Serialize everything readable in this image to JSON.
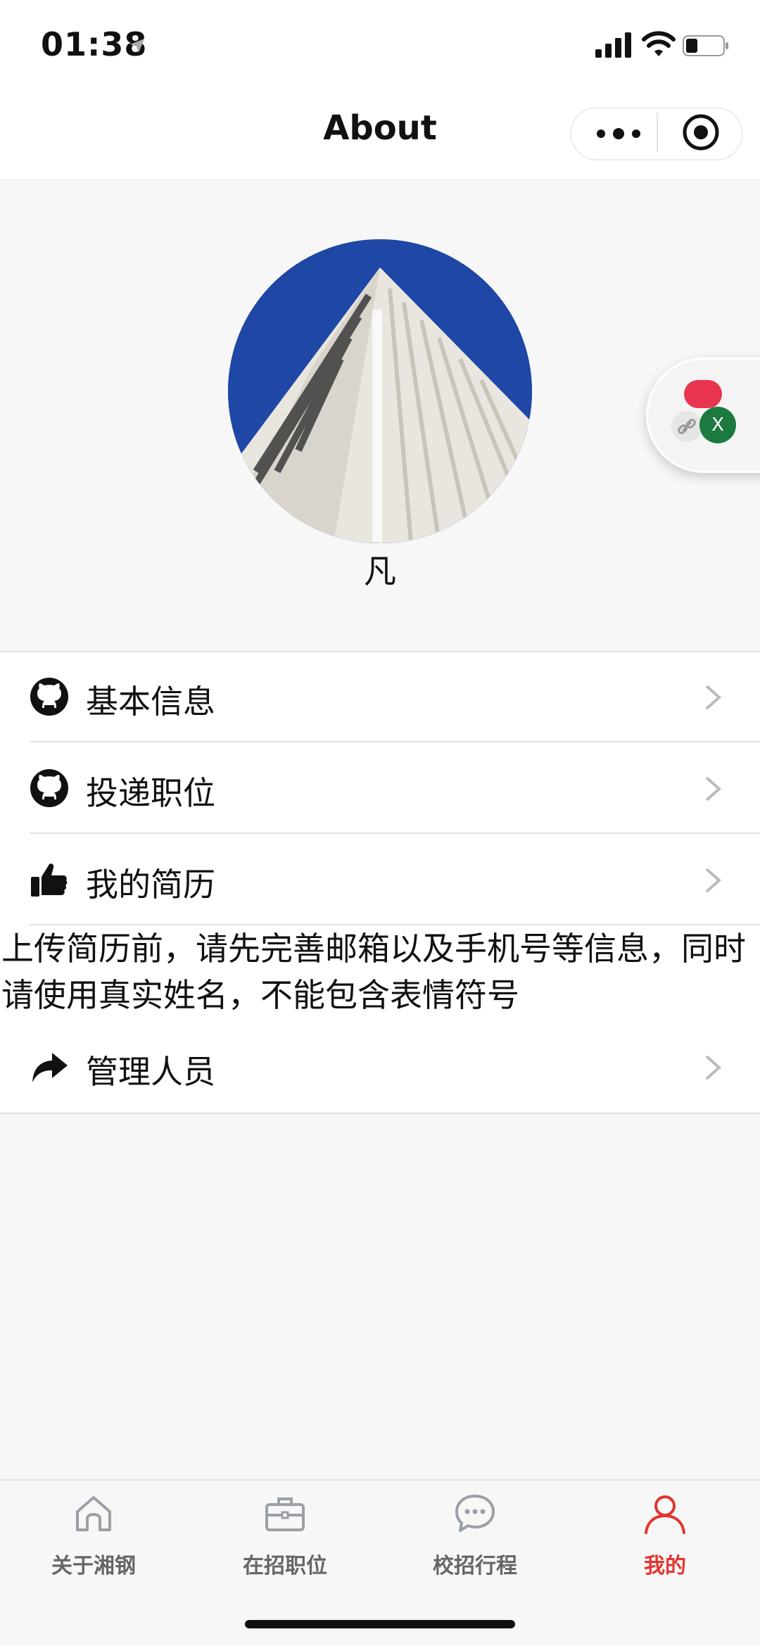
{
  "status_bar": {
    "time": "01:38"
  },
  "nav": {
    "title": "About"
  },
  "profile": {
    "username": "凡"
  },
  "menu": [
    {
      "label": "基本信息",
      "icon": "github-icon"
    },
    {
      "label": "投递职位",
      "icon": "github-icon"
    },
    {
      "label": "我的简历",
      "icon": "thumbs-up-icon"
    }
  ],
  "notice": {
    "line1": "上传简历前，请先完善邮箱以及手机号等信息，同时",
    "line2": "请使用真实姓名，不能包含表情符号"
  },
  "menu_extra": {
    "label": "管理人员",
    "icon": "share-arrow-icon"
  },
  "floating_widget": {
    "x_label": "X"
  },
  "tabbar": {
    "tabs": [
      {
        "label": "关于湘钢",
        "icon": "home-icon"
      },
      {
        "label": "在招职位",
        "icon": "briefcase-icon"
      },
      {
        "label": "校招行程",
        "icon": "chat-bubble-icon"
      },
      {
        "label": "我的",
        "icon": "person-icon"
      }
    ],
    "active_index": 3
  },
  "colors": {
    "accent": "#e3342f",
    "avatar_sky": "#1f47a6"
  }
}
